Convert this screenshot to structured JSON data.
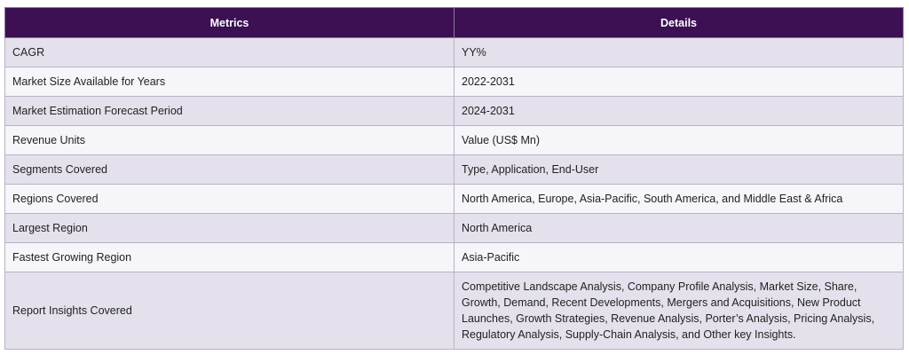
{
  "header": {
    "metrics_label": "Metrics",
    "details_label": "Details"
  },
  "rows": [
    {
      "metric": "CAGR",
      "detail": "YY%"
    },
    {
      "metric": "Market Size Available for Years",
      "detail": "2022-2031"
    },
    {
      "metric": "Market Estimation Forecast Period",
      "detail": "2024-2031"
    },
    {
      "metric": "Revenue Units",
      "detail": "Value (US$ Mn)"
    },
    {
      "metric": "Segments Covered",
      "detail": "Type, Application, End-User"
    },
    {
      "metric": "Regions Covered",
      "detail": "North America, Europe, Asia-Pacific, South America, and Middle East & Africa"
    },
    {
      "metric": "Largest Region",
      "detail": "North America"
    },
    {
      "metric": "Fastest Growing Region",
      "detail": "Asia-Pacific"
    },
    {
      "metric": "Report Insights Covered",
      "detail": "Competitive Landscape Analysis, Company Profile Analysis, Market Size, Share, Growth, Demand, Recent Developments, Mergers and Acquisitions, New Product Launches, Growth Strategies, Revenue Analysis, Porter’s Analysis, Pricing Analysis, Regulatory Analysis, Supply-Chain Analysis, and Other key Insights."
    }
  ],
  "colors": {
    "header_bg": "#3c1053",
    "row_odd": "#e4e1ec",
    "row_even": "#f6f5fa"
  }
}
